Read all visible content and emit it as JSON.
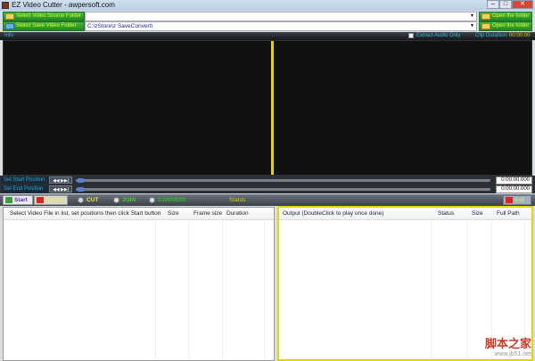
{
  "window": {
    "title": "EZ Video Cutter - awpersoft.com",
    "minimize": "–",
    "maximize": "□",
    "close": "✕"
  },
  "folders": {
    "source": {
      "button": "Select Video Source Folder",
      "path": "",
      "open": "Open the folder"
    },
    "save": {
      "button": "Select Save Video Folder",
      "path": "C:\\zStore\\z SaveConvert\\",
      "open": "Open the folder"
    }
  },
  "infobar": {
    "info": "Info",
    "extract_audio": "Extract Audio Only",
    "clip_duration_label": "Clip Duration:",
    "clip_duration": "00:00:00"
  },
  "positions": {
    "start_label": "Set Start Position",
    "end_label": "Set End Position",
    "nav": "◀◀ ▶▶|",
    "start_time": "0:00:00.000",
    "end_time": "0:00:00.000"
  },
  "toolbar": {
    "start": "Start",
    "cancel": "Cancel",
    "cut": "CUT",
    "join": "JOIN",
    "convert": "CONVERT",
    "status": "Status",
    "exit": "Exit"
  },
  "input_list": {
    "columns": [
      "Select Video File in list, set positions then click Start button",
      "Size",
      "Frame size",
      "Duration"
    ]
  },
  "output_list": {
    "columns": [
      "Output (DoubleClick to play once done)",
      "Status",
      "Size",
      "Full Path"
    ]
  },
  "watermark": {
    "text": "脚本之家",
    "url": "www.jb51.net"
  },
  "colors": {
    "accent": "#e5d800",
    "button_green": "#2fa02f"
  }
}
